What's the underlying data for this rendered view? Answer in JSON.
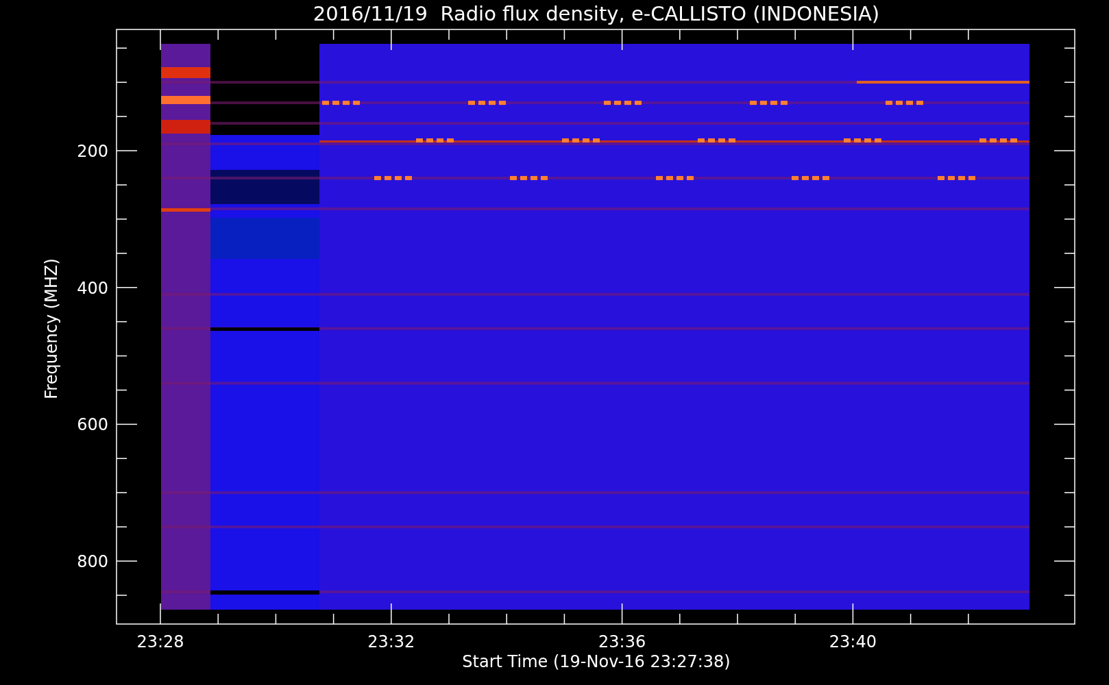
{
  "title": "2016/11/19  Radio flux density, e-CALLISTO (INDONESIA)",
  "y_axis": {
    "label": "Frequency (MHZ)",
    "ticks": [
      "200",
      "400",
      "600",
      "800"
    ]
  },
  "x_axis": {
    "label": "Start Time (19-Nov-16 23:27:38)",
    "ticks": [
      "23:28",
      "23:32",
      "23:36",
      "23:40"
    ]
  }
}
